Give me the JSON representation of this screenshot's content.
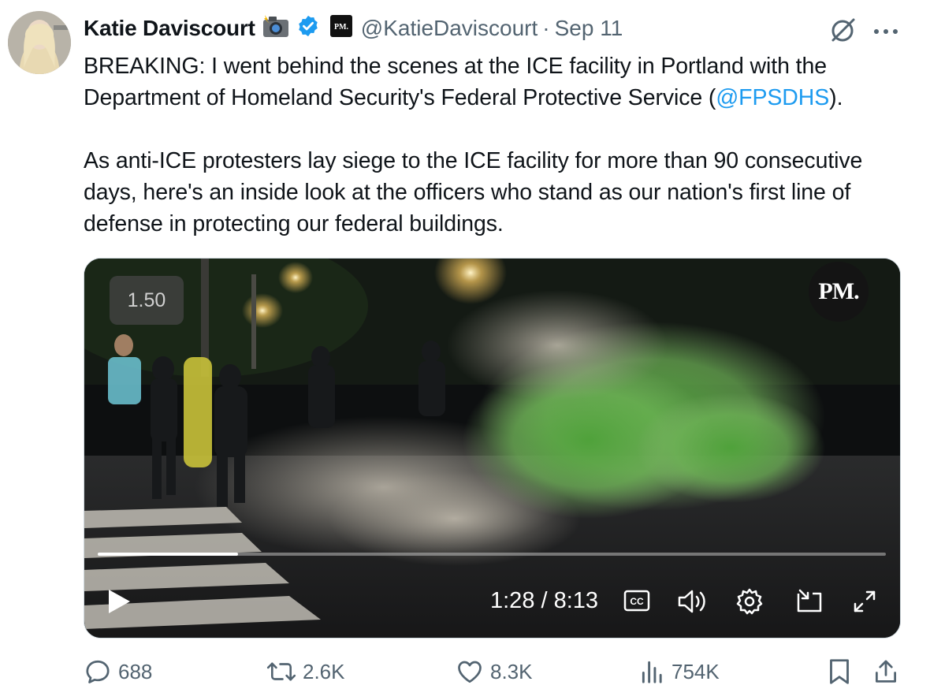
{
  "author": {
    "name": "Katie Daviscourt",
    "handle": "@KatieDaviscourt",
    "separator": "·",
    "date": "Sep 11",
    "affiliate_badge_text": "PM."
  },
  "tweet": {
    "paragraph1_text": "BREAKING: I went behind the scenes at the ICE facility in Portland with the Department of Homeland Security's Federal Protective Service (",
    "paragraph1_mention": "@FPSDHS",
    "paragraph1_tail": ").",
    "paragraph2": "As anti-ICE protesters lay siege to the ICE facility for more than 90 consecutive days, here's an inside look at the officers who stand as our nation's first line of defense in protecting our federal buildings."
  },
  "video": {
    "speed": "1.50",
    "logo": "PM.",
    "time_display": "1:28 / 8:13",
    "progress_fraction": 0.178,
    "cc_label": "CC"
  },
  "actions": {
    "replies": "688",
    "reposts": "2.6K",
    "likes": "8.3K",
    "views": "754K"
  },
  "colors": {
    "accent": "#1d9bf0",
    "muted": "#536471",
    "text": "#0f1419"
  },
  "icons": [
    "verified-badge-icon",
    "camera-flash-emoji-icon",
    "grok-icon",
    "more-icon",
    "play-icon",
    "cc-icon",
    "volume-icon",
    "settings-gear-icon",
    "picture-in-picture-icon",
    "fullscreen-icon",
    "reply-icon",
    "repost-icon",
    "like-icon",
    "views-icon",
    "bookmark-icon",
    "share-icon"
  ]
}
